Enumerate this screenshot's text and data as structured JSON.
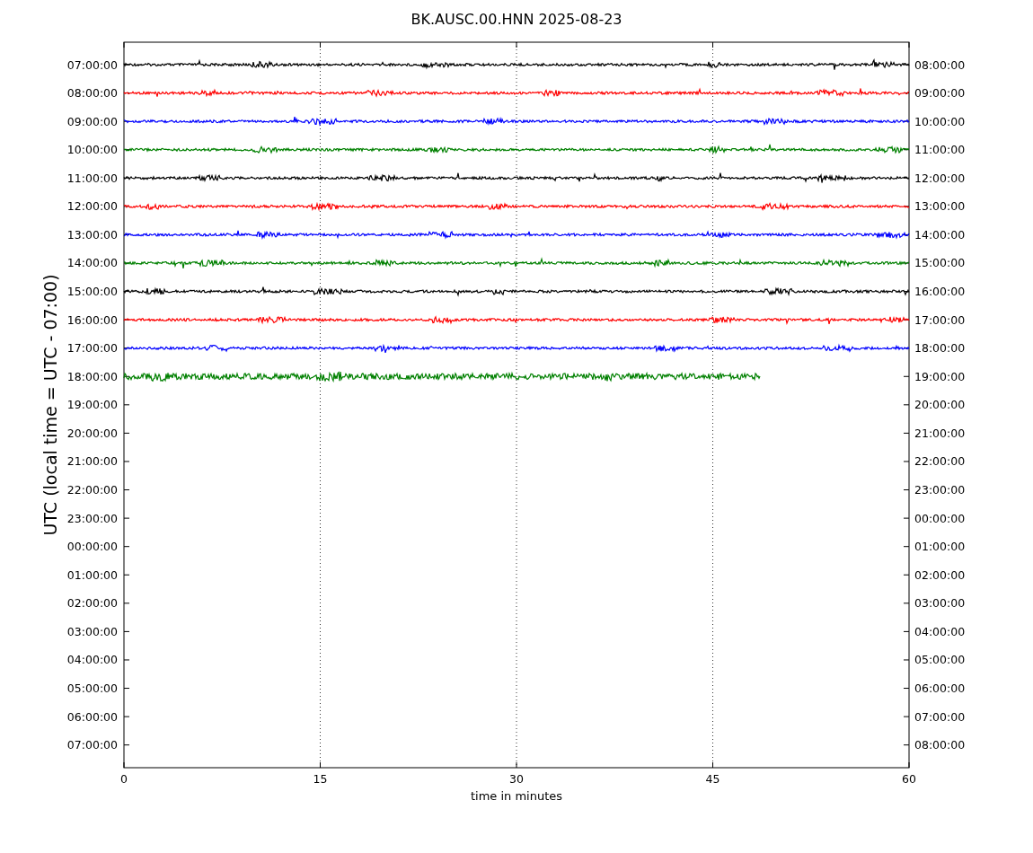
{
  "title": "BK.AUSC.00.HNN 2025-08-23",
  "y_axis": {
    "label": "UTC (local time = UTC - 07:00)"
  },
  "x_axis": {
    "label": "time in minutes",
    "ticks": [
      "0",
      "15",
      "30",
      "45",
      "60"
    ]
  },
  "rows": [
    {
      "left": "07:00:00",
      "right": "08:00:00"
    },
    {
      "left": "08:00:00",
      "right": "09:00:00"
    },
    {
      "left": "09:00:00",
      "right": "10:00:00"
    },
    {
      "left": "10:00:00",
      "right": "11:00:00"
    },
    {
      "left": "11:00:00",
      "right": "12:00:00"
    },
    {
      "left": "12:00:00",
      "right": "13:00:00"
    },
    {
      "left": "13:00:00",
      "right": "14:00:00"
    },
    {
      "left": "14:00:00",
      "right": "15:00:00"
    },
    {
      "left": "15:00:00",
      "right": "16:00:00"
    },
    {
      "left": "16:00:00",
      "right": "17:00:00"
    },
    {
      "left": "17:00:00",
      "right": "18:00:00"
    },
    {
      "left": "18:00:00",
      "right": "19:00:00"
    },
    {
      "left": "19:00:00",
      "right": "20:00:00"
    },
    {
      "left": "20:00:00",
      "right": "21:00:00"
    },
    {
      "left": "21:00:00",
      "right": "22:00:00"
    },
    {
      "left": "22:00:00",
      "right": "23:00:00"
    },
    {
      "left": "23:00:00",
      "right": "00:00:00"
    },
    {
      "left": "00:00:00",
      "right": "01:00:00"
    },
    {
      "left": "01:00:00",
      "right": "02:00:00"
    },
    {
      "left": "02:00:00",
      "right": "03:00:00"
    },
    {
      "left": "03:00:00",
      "right": "04:00:00"
    },
    {
      "left": "04:00:00",
      "right": "05:00:00"
    },
    {
      "left": "05:00:00",
      "right": "06:00:00"
    },
    {
      "left": "06:00:00",
      "right": "07:00:00"
    },
    {
      "left": "07:00:00",
      "right": "08:00:00"
    }
  ],
  "traces": [
    {
      "color": "#000000",
      "level": 1
    },
    {
      "color": "#ff0000",
      "level": 1
    },
    {
      "color": "#0000ff",
      "level": 1
    },
    {
      "color": "#008000",
      "level": 1
    },
    {
      "color": "#000000",
      "level": 1
    },
    {
      "color": "#ff0000",
      "level": 1
    },
    {
      "color": "#0000ff",
      "level": 1
    },
    {
      "color": "#008000",
      "level": 1
    },
    {
      "color": "#000000",
      "level": 1
    },
    {
      "color": "#ff0000",
      "level": 1
    },
    {
      "color": "#0000ff",
      "level": 1
    },
    {
      "color": "#008000",
      "level": 0.81
    }
  ]
}
